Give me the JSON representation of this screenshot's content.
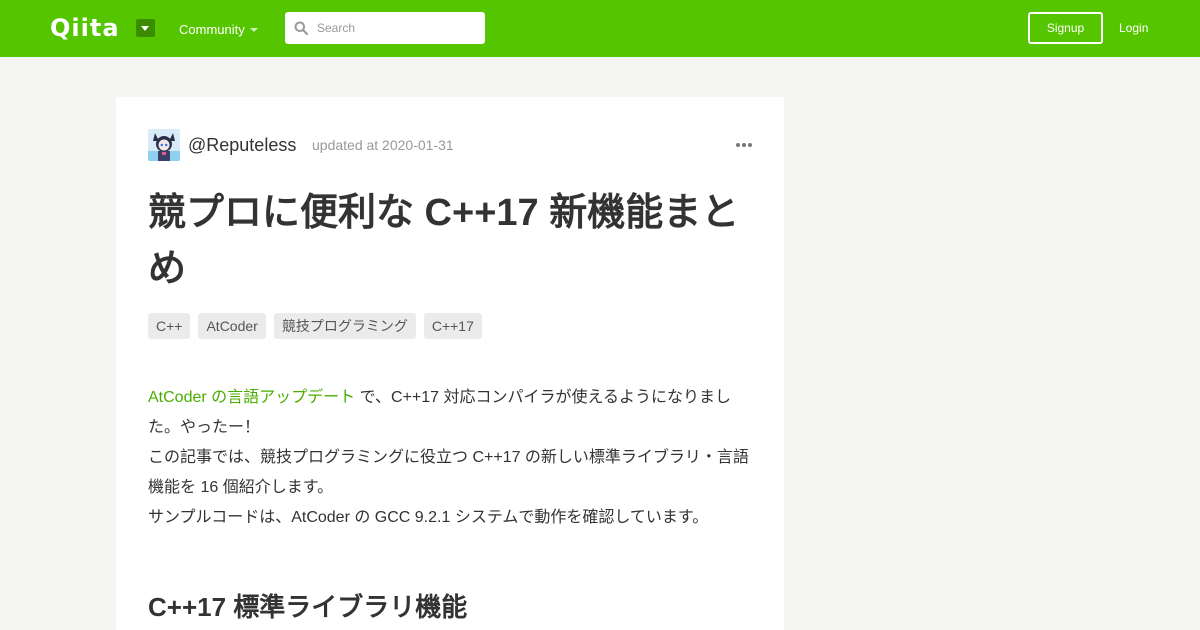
{
  "header": {
    "logo": "Qiita",
    "community_label": "Community",
    "search_placeholder": "Search",
    "signup_label": "Signup",
    "login_label": "Login",
    "brand_color": "#55c500"
  },
  "article": {
    "author": "@Reputeless",
    "updated": "updated at 2020-01-31",
    "title": "競プロに便利な C++17 新機能まとめ",
    "tags": [
      "C++",
      "AtCoder",
      "競技プログラミング",
      "C++17"
    ],
    "body": {
      "link_text": "AtCoder の言語アップデート",
      "line1": " で、C++17 対応コンパイラが使えるようになりました。やったー！",
      "line2": "この記事では、競技プログラミングに役立つ C++17 の新しい標準ライブラリ・言語機能を 16 個紹介します。",
      "line3": "サンプルコードは、AtCoder の GCC 9.2.1 システムで動作を確認しています。",
      "link_color": "#4bad00"
    },
    "section_heading": "C++17 標準ライブラリ機能"
  },
  "icons": {
    "search": "search-icon",
    "more": "more-icon",
    "dropdown": "chevron-down-icon"
  }
}
